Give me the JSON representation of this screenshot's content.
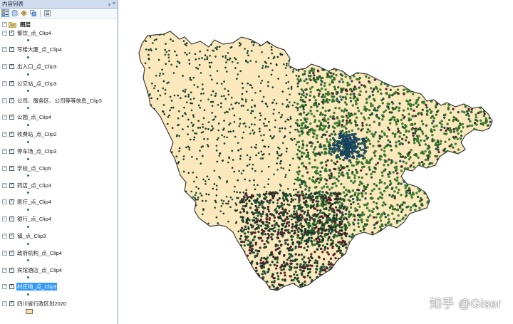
{
  "toc": {
    "title": "内容列表",
    "controls": {
      "pin": "ᵩ",
      "close": "×"
    },
    "root": {
      "label": "图层",
      "expander": "−"
    },
    "layers": [
      {
        "name": "餐饮_点_Clip4",
        "checked": "✓",
        "expander": "−",
        "symbol": "point"
      },
      {
        "name": "写楼大厦_点_Clip4",
        "checked": "✓",
        "expander": "−",
        "symbol": "point"
      },
      {
        "name": "出入口_点_Clip3",
        "checked": "✓",
        "expander": "−",
        "symbol": "point"
      },
      {
        "name": "公交站_点_Clip3",
        "checked": "✓",
        "expander": "−",
        "symbol": "point"
      },
      {
        "name": "公司、服务区、公司等等信息_Clip3",
        "checked": "✓",
        "expander": "−",
        "symbol": "point"
      },
      {
        "name": "公园_点_Clip4",
        "checked": "✓",
        "expander": "−",
        "symbol": "point"
      },
      {
        "name": "收费站_点_Clip2",
        "checked": "✓",
        "expander": "−",
        "symbol": "point"
      },
      {
        "name": "停车场_点_Clip3",
        "checked": "✓",
        "expander": "−",
        "symbol": "point"
      },
      {
        "name": "学校_点_Clip5",
        "checked": "✓",
        "expander": "−",
        "symbol": "point"
      },
      {
        "name": "药店_点_Clip3",
        "checked": "✓",
        "expander": "−",
        "symbol": "point"
      },
      {
        "name": "医疗_点_Clip4",
        "checked": "✓",
        "expander": "−",
        "symbol": "point"
      },
      {
        "name": "银行_点_Clip4",
        "checked": "✓",
        "expander": "−",
        "symbol": "point"
      },
      {
        "name": "镇_点_Clip3",
        "checked": "✓",
        "expander": "−",
        "symbol": "point"
      },
      {
        "name": "政府机构_点_Clip4",
        "checked": "✓",
        "expander": "−",
        "symbol": "point"
      },
      {
        "name": "宾馆酒店_点_Clip4",
        "checked": "✓",
        "expander": "−",
        "symbol": "point"
      },
      {
        "name": "村庄地_点_Clip3",
        "checked": "✓",
        "expander": "−",
        "symbol": "point",
        "selected": true
      },
      {
        "name": "四川省行政区划2020",
        "checked": "✓",
        "expander": "−",
        "symbol": "polygon"
      }
    ]
  },
  "map": {
    "province_fill": "#fbe9bd",
    "province_stroke": "#3c3c3c",
    "point_colors": [
      "#2a7a2a",
      "#1f5a3a",
      "#1d4f7a",
      "#6b1430",
      "#3a8f2a",
      "#0f3b2a"
    ]
  },
  "watermark": "知乎 @Giser"
}
